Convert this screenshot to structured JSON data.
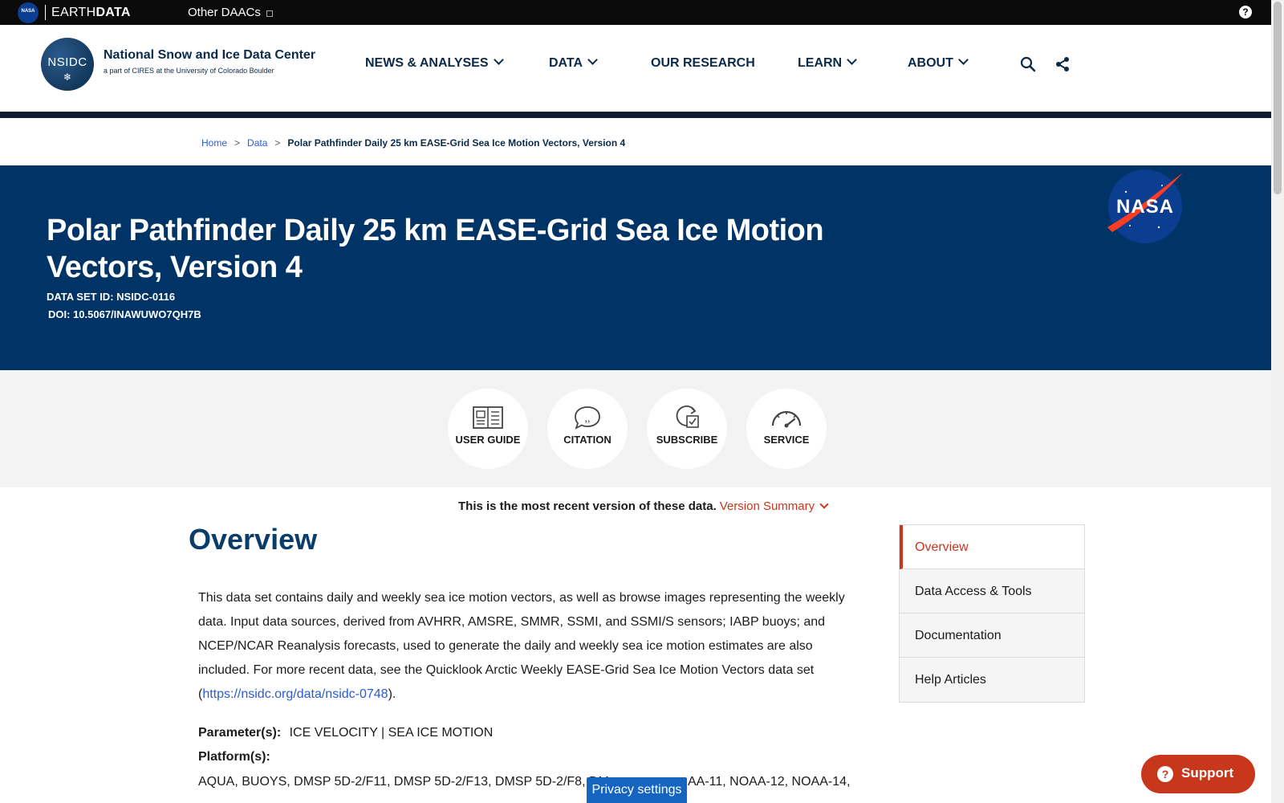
{
  "earthdata_bar": {
    "nasa_badge": "NASA",
    "brand_prefix": "EARTH",
    "brand_suffix": "DATA",
    "other_daacs": "Other DAACs",
    "help": "?"
  },
  "header": {
    "logo_text": "NSIDC",
    "org_name": "National Snow and Ice Data Center",
    "org_sub": "a part of CIRES at the University of Colorado Boulder",
    "nav": [
      {
        "label": "NEWS & ANALYSES",
        "has_menu": true
      },
      {
        "label": "DATA",
        "has_menu": true
      },
      {
        "label": "OUR RESEARCH",
        "has_menu": false
      },
      {
        "label": "LEARN",
        "has_menu": true
      },
      {
        "label": "ABOUT",
        "has_menu": true
      }
    ],
    "icons": [
      "search-icon",
      "share-icon"
    ]
  },
  "breadcrumb": {
    "home": "Home",
    "sep": ">",
    "data": "Data",
    "current": "Polar Pathfinder Daily 25 km EASE-Grid Sea Ice Motion Vectors, Version 4"
  },
  "hero": {
    "title": "Polar Pathfinder Daily 25 km EASE-Grid Sea Ice Motion Vectors, Version 4",
    "dataset_id": "DATA SET ID: NSIDC-0116",
    "doi": "DOI: 10.5067/INAWUWO7QH7B",
    "nasa_logo_text": "NASA"
  },
  "actions": [
    {
      "label": "USER GUIDE",
      "icon": "user-guide-icon"
    },
    {
      "label": "CITATION",
      "icon": "citation-icon"
    },
    {
      "label": "SUBSCRIBE",
      "icon": "subscribe-icon"
    },
    {
      "label": "SERVICE",
      "icon": "service-icon"
    }
  ],
  "version": {
    "text": "This is the most recent version of these data.",
    "link": "Version Summary"
  },
  "overview": {
    "title": "Overview",
    "body_before_link": "This data set contains daily and weekly sea ice motion vectors, as well as browse images representing the weekly data. Input data sources, derived from AVHRR, AMSRE, SMMR, SSMI, and SSMI/S sensors; IABP buoys; and NCEP/NCAR Reanalysis forecasts, used to generate the daily and weekly sea ice motion estimates are also included. For more recent data, see the Quicklook Arctic Weekly EASE-Grid Sea Ice Motion Vectors data set (",
    "body_link": "https://nsidc.org/data/nsidc-0748",
    "body_after_link": ").",
    "parameters_label": "Parameter(s):",
    "parameters_value": "ICE VELOCITY | SEA ICE MOTION",
    "platforms_label": "Platform(s):",
    "platforms_value_a": "AQUA, BUOYS, DMSP 5D-2/F11, DMSP 5D-2/F13, DMSP 5D-2/F8, DM",
    "platforms_value_b": "AA-11, NOAA-12, NOAA-14,"
  },
  "side_nav": [
    {
      "label": "Overview",
      "active": true
    },
    {
      "label": "Data Access & Tools",
      "active": false
    },
    {
      "label": "Documentation",
      "active": false
    },
    {
      "label": "Help Articles",
      "active": false
    }
  ],
  "floating": {
    "privacy": "Privacy settings",
    "support": "Support",
    "support_icon": "?"
  }
}
